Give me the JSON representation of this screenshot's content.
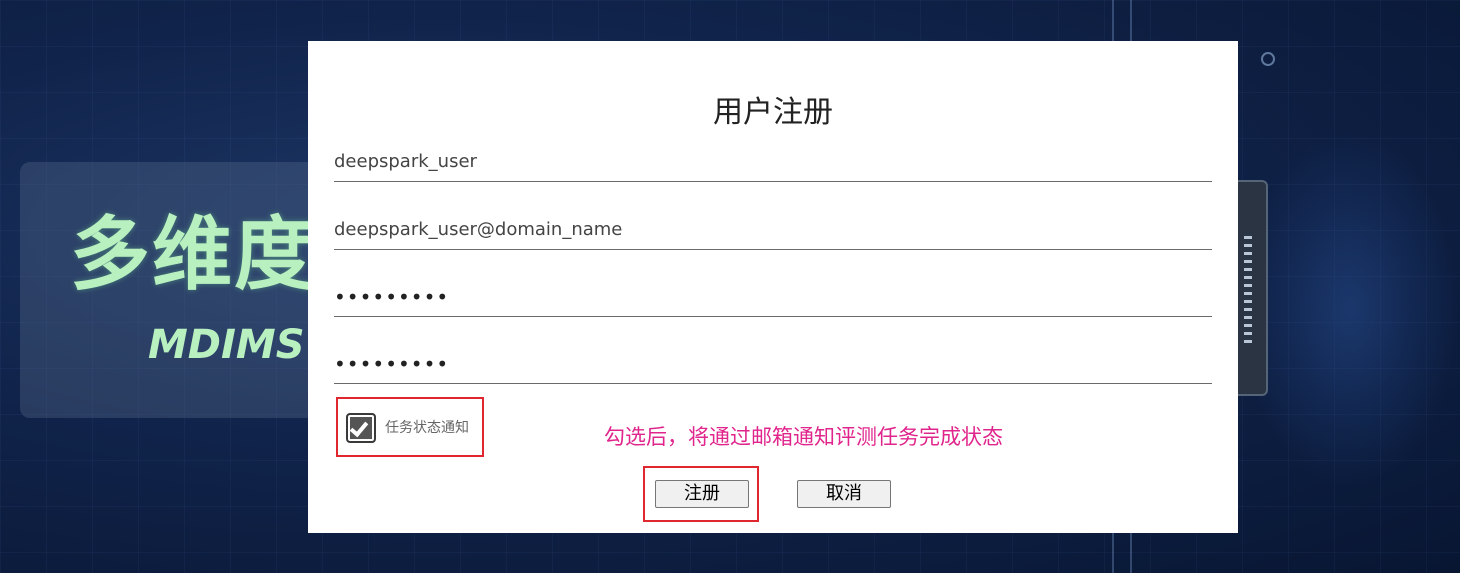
{
  "background": {
    "banner_title": "多维度评",
    "banner_subtitle": "MDIMS Be"
  },
  "dialog": {
    "title": "用户注册",
    "fields": {
      "username": "deepspark_user",
      "email": "deepspark_user@domain_name",
      "password": "•••••••••",
      "confirm_password": "•••••••••"
    },
    "notify_checkbox": {
      "label": "任务状态通知",
      "checked": true
    },
    "hint": "勾选后，将通过邮箱通知评测任务完成状态",
    "buttons": {
      "register": "注册",
      "cancel": "取消"
    }
  },
  "colors": {
    "highlight_box": "#e0262e",
    "hint_text": "#e0268c",
    "banner_text": "#b8f0c0"
  }
}
